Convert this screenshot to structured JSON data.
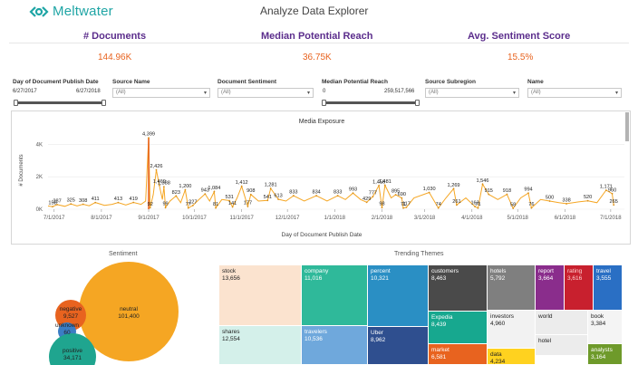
{
  "header": {
    "brand": "Meltwater",
    "title": "Analyze Data Explorer"
  },
  "kpis": [
    {
      "label": "# Documents",
      "value": "144.96K"
    },
    {
      "label": "Median Potential Reach",
      "value": "36.75K"
    },
    {
      "label": "Avg. Sentiment Score",
      "value": "15.5%"
    }
  ],
  "filters": {
    "date": {
      "label": "Day of Document Publish Date",
      "start": "6/27/2017",
      "end": "6/27/2018"
    },
    "source_name": {
      "label": "Source Name",
      "value": "(All)"
    },
    "sentiment": {
      "label": "Document Sentiment",
      "value": "(All)"
    },
    "reach": {
      "label": "Median Potential Reach",
      "min": "0",
      "max": "259,517,566"
    },
    "subregion": {
      "label": "Source Subregion",
      "value": "(All)"
    },
    "name": {
      "label": "Name",
      "value": "(All)"
    }
  },
  "colors": {
    "brand_teal": "#1fa5a5",
    "kpi_purple": "#5b2d8c",
    "kpi_orange": "#e8631f",
    "line_orange": "#f5a623",
    "spike": "#e8631f"
  },
  "chart_data": {
    "type": "line",
    "title": "Media Exposure",
    "xlabel": "Day of Document Publish Date",
    "ylabel": "# Documents",
    "yticks": [
      "0K",
      "2K",
      "4K"
    ],
    "ylim": [
      0,
      4800
    ],
    "xlim": [
      "2017-06-27",
      "2018-07-10"
    ],
    "xticks": [
      "7/1/2017",
      "8/1/2017",
      "9/1/2017",
      "10/1/2017",
      "11/1/2017",
      "12/1/2017",
      "1/1/2018",
      "2/1/2018",
      "3/1/2018",
      "4/1/2018",
      "5/1/2018",
      "6/1/2018",
      "7/1/2018"
    ],
    "grid": true,
    "annotations": [
      {
        "x": "2017-06-30",
        "y": 158,
        "text": "158"
      },
      {
        "x": "2017-07-03",
        "y": 287,
        "text": "287"
      },
      {
        "x": "2017-07-12",
        "y": 325,
        "text": "325"
      },
      {
        "x": "2017-07-20",
        "y": 308,
        "text": "308"
      },
      {
        "x": "2017-07-28",
        "y": 411,
        "text": "411"
      },
      {
        "x": "2017-08-12",
        "y": 413,
        "text": "413"
      },
      {
        "x": "2017-08-22",
        "y": 419,
        "text": "419"
      },
      {
        "x": "2017-09-01",
        "y": 4399,
        "text": "4,399"
      },
      {
        "x": "2017-09-02",
        "y": 92,
        "text": "92"
      },
      {
        "x": "2017-09-06",
        "y": 2426,
        "text": "2,426"
      },
      {
        "x": "2017-09-08",
        "y": 1469,
        "text": "1,469"
      },
      {
        "x": "2017-09-11",
        "y": 1388,
        "text": "1,388"
      },
      {
        "x": "2017-09-12",
        "y": 99,
        "text": "99"
      },
      {
        "x": "2017-09-19",
        "y": 823,
        "text": "823"
      },
      {
        "x": "2017-09-25",
        "y": 1200,
        "text": "1,200"
      },
      {
        "x": "2017-09-27",
        "y": 77,
        "text": "77"
      },
      {
        "x": "2017-09-30",
        "y": 227,
        "text": "227"
      },
      {
        "x": "2017-10-08",
        "y": 943,
        "text": "943"
      },
      {
        "x": "2017-10-14",
        "y": 1084,
        "text": "1,084"
      },
      {
        "x": "2017-10-15",
        "y": 81,
        "text": "81"
      },
      {
        "x": "2017-10-24",
        "y": 531,
        "text": "531"
      },
      {
        "x": "2017-10-26",
        "y": 141,
        "text": "141"
      },
      {
        "x": "2017-11-01",
        "y": 1412,
        "text": "1,412"
      },
      {
        "x": "2017-11-05",
        "y": 177,
        "text": "177"
      },
      {
        "x": "2017-11-07",
        "y": 908,
        "text": "908"
      },
      {
        "x": "2017-11-20",
        "y": 1281,
        "text": "1,281"
      },
      {
        "x": "2017-11-18",
        "y": 541,
        "text": "541"
      },
      {
        "x": "2017-11-25",
        "y": 613,
        "text": "613"
      },
      {
        "x": "2017-12-05",
        "y": 833,
        "text": "833"
      },
      {
        "x": "2017-12-20",
        "y": 834,
        "text": "834"
      },
      {
        "x": "2018-01-03",
        "y": 833,
        "text": "833"
      },
      {
        "x": "2018-01-13",
        "y": 993,
        "text": "993"
      },
      {
        "x": "2018-01-22",
        "y": 429,
        "text": "429"
      },
      {
        "x": "2018-01-26",
        "y": 777,
        "text": "777"
      },
      {
        "x": "2018-01-30",
        "y": 1456,
        "text": "1,456"
      },
      {
        "x": "2018-02-03",
        "y": 1481,
        "text": "1,481"
      },
      {
        "x": "2018-02-01",
        "y": 98,
        "text": "98"
      },
      {
        "x": "2018-02-10",
        "y": 895,
        "text": "895"
      },
      {
        "x": "2018-02-14",
        "y": 690,
        "text": "690"
      },
      {
        "x": "2018-02-15",
        "y": 71,
        "text": "71"
      },
      {
        "x": "2018-02-17",
        "y": 117,
        "text": "117"
      },
      {
        "x": "2018-03-04",
        "y": 1030,
        "text": "1,030"
      },
      {
        "x": "2018-03-10",
        "y": 74,
        "text": "74"
      },
      {
        "x": "2018-03-20",
        "y": 1269,
        "text": "1,269"
      },
      {
        "x": "2018-03-22",
        "y": 261,
        "text": "261"
      },
      {
        "x": "2018-04-03",
        "y": 163,
        "text": "163"
      },
      {
        "x": "2018-04-05",
        "y": 71,
        "text": "71"
      },
      {
        "x": "2018-04-08",
        "y": 1546,
        "text": "1,546"
      },
      {
        "x": "2018-04-12",
        "y": 915,
        "text": "915"
      },
      {
        "x": "2018-04-24",
        "y": 918,
        "text": "918"
      },
      {
        "x": "2018-04-28",
        "y": 58,
        "text": "58"
      },
      {
        "x": "2018-05-08",
        "y": 994,
        "text": "994"
      },
      {
        "x": "2018-05-10",
        "y": 76,
        "text": "76"
      },
      {
        "x": "2018-05-22",
        "y": 500,
        "text": "500"
      },
      {
        "x": "2018-06-02",
        "y": 338,
        "text": "338"
      },
      {
        "x": "2018-06-16",
        "y": 520,
        "text": "520"
      },
      {
        "x": "2018-06-28",
        "y": 1171,
        "text": "1,171"
      },
      {
        "x": "2018-07-02",
        "y": 960,
        "text": "960"
      },
      {
        "x": "2018-07-03",
        "y": 265,
        "text": "265"
      }
    ],
    "series": [
      {
        "values": [
          [
            "2017-06-27",
            200
          ],
          [
            "2017-06-30",
            158
          ],
          [
            "2017-07-03",
            287
          ],
          [
            "2017-07-08",
            180
          ],
          [
            "2017-07-12",
            325
          ],
          [
            "2017-07-16",
            200
          ],
          [
            "2017-07-20",
            308
          ],
          [
            "2017-07-24",
            210
          ],
          [
            "2017-07-28",
            411
          ],
          [
            "2017-08-03",
            240
          ],
          [
            "2017-08-08",
            300
          ],
          [
            "2017-08-12",
            413
          ],
          [
            "2017-08-17",
            260
          ],
          [
            "2017-08-22",
            419
          ],
          [
            "2017-08-27",
            300
          ],
          [
            "2017-08-30",
            500
          ],
          [
            "2017-09-01",
            4399
          ],
          [
            "2017-09-02",
            92
          ],
          [
            "2017-09-04",
            900
          ],
          [
            "2017-09-06",
            2426
          ],
          [
            "2017-09-08",
            1469
          ],
          [
            "2017-09-10",
            600
          ],
          [
            "2017-09-11",
            1388
          ],
          [
            "2017-09-12",
            99
          ],
          [
            "2017-09-15",
            500
          ],
          [
            "2017-09-19",
            823
          ],
          [
            "2017-09-22",
            400
          ],
          [
            "2017-09-25",
            1200
          ],
          [
            "2017-09-27",
            77
          ],
          [
            "2017-09-30",
            227
          ],
          [
            "2017-10-04",
            600
          ],
          [
            "2017-10-08",
            943
          ],
          [
            "2017-10-11",
            500
          ],
          [
            "2017-10-14",
            1084
          ],
          [
            "2017-10-15",
            81
          ],
          [
            "2017-10-19",
            600
          ],
          [
            "2017-10-24",
            531
          ],
          [
            "2017-10-26",
            141
          ],
          [
            "2017-10-29",
            700
          ],
          [
            "2017-11-01",
            1412
          ],
          [
            "2017-11-05",
            177
          ],
          [
            "2017-11-07",
            908
          ],
          [
            "2017-11-12",
            500
          ],
          [
            "2017-11-18",
            541
          ],
          [
            "2017-11-20",
            1281
          ],
          [
            "2017-11-25",
            613
          ],
          [
            "2017-11-30",
            500
          ],
          [
            "2017-12-05",
            833
          ],
          [
            "2017-12-12",
            500
          ],
          [
            "2017-12-20",
            834
          ],
          [
            "2017-12-27",
            500
          ],
          [
            "2018-01-03",
            833
          ],
          [
            "2018-01-08",
            600
          ],
          [
            "2018-01-13",
            993
          ],
          [
            "2018-01-18",
            600
          ],
          [
            "2018-01-22",
            429
          ],
          [
            "2018-01-26",
            777
          ],
          [
            "2018-01-30",
            1456
          ],
          [
            "2018-02-01",
            98
          ],
          [
            "2018-02-03",
            1481
          ],
          [
            "2018-02-07",
            700
          ],
          [
            "2018-02-10",
            895
          ],
          [
            "2018-02-14",
            690
          ],
          [
            "2018-02-15",
            71
          ],
          [
            "2018-02-17",
            117
          ],
          [
            "2018-02-22",
            700
          ],
          [
            "2018-03-04",
            1030
          ],
          [
            "2018-03-10",
            74
          ],
          [
            "2018-03-15",
            700
          ],
          [
            "2018-03-20",
            1269
          ],
          [
            "2018-03-22",
            261
          ],
          [
            "2018-03-28",
            700
          ],
          [
            "2018-04-03",
            163
          ],
          [
            "2018-04-05",
            71
          ],
          [
            "2018-04-08",
            1546
          ],
          [
            "2018-04-12",
            915
          ],
          [
            "2018-04-18",
            600
          ],
          [
            "2018-04-24",
            918
          ],
          [
            "2018-04-28",
            58
          ],
          [
            "2018-05-03",
            700
          ],
          [
            "2018-05-08",
            994
          ],
          [
            "2018-05-10",
            76
          ],
          [
            "2018-05-16",
            600
          ],
          [
            "2018-05-22",
            500
          ],
          [
            "2018-05-28",
            400
          ],
          [
            "2018-06-02",
            338
          ],
          [
            "2018-06-10",
            450
          ],
          [
            "2018-06-16",
            520
          ],
          [
            "2018-06-22",
            400
          ],
          [
            "2018-06-28",
            1171
          ],
          [
            "2018-07-02",
            960
          ],
          [
            "2018-07-03",
            265
          ]
        ]
      }
    ]
  },
  "sentiment": {
    "title": "Sentiment",
    "bubbles": [
      {
        "label": "neutral",
        "value": "101,400",
        "color": "#f5a623"
      },
      {
        "label": "negative",
        "value": "9,527",
        "color": "#e8631f"
      },
      {
        "label": "unknown",
        "value": "60",
        "color": "#3b7dc4"
      },
      {
        "label": "positive",
        "value": "34,171",
        "color": "#1fa58f"
      }
    ]
  },
  "trending": {
    "title": "Trending Themes",
    "tiles": [
      {
        "label": "stock",
        "value": "13,656",
        "color": "#fbe3cf"
      },
      {
        "label": "shares",
        "value": "12,554",
        "color": "#d4f0ea"
      },
      {
        "label": "company",
        "value": "11,016",
        "color": "#2fb99a"
      },
      {
        "label": "travelers",
        "value": "10,536",
        "color": "#6fa8dc"
      },
      {
        "label": "percent",
        "value": "10,321",
        "color": "#2a8fc4"
      },
      {
        "label": "Uber",
        "value": "8,962",
        "color": "#2f4f8f"
      },
      {
        "label": "customers",
        "value": "8,463",
        "color": "#4a4a4a"
      },
      {
        "label": "Expedia",
        "value": "8,439",
        "color": "#17a88f"
      },
      {
        "label": "market",
        "value": "6,581",
        "color": "#e8631f"
      },
      {
        "label": "hotels",
        "value": "5,792",
        "color": "#7f7f7f"
      },
      {
        "label": "investors",
        "value": "4,960",
        "color": "#f2f2f2"
      },
      {
        "label": "data",
        "value": "4,234",
        "color": "#ffd21f"
      },
      {
        "label": "report",
        "value": "3,664",
        "color": "#8a2d8c"
      },
      {
        "label": "rating",
        "value": "3,616",
        "color": "#c8202e"
      },
      {
        "label": "travel",
        "value": "3,555",
        "color": "#2a6fc4"
      },
      {
        "label": "world",
        "value": "",
        "color": "#ececec"
      },
      {
        "label": "book",
        "value": "3,384",
        "color": "#f4f4f4"
      },
      {
        "label": "hotel",
        "value": "",
        "color": "#ececec"
      },
      {
        "label": "analysts",
        "value": "3,164",
        "color": "#6e9a2a"
      }
    ]
  }
}
